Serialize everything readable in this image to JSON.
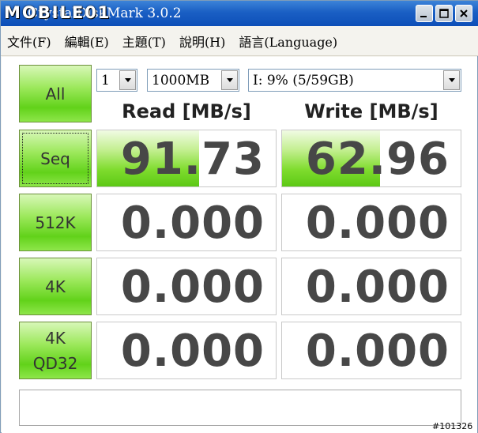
{
  "window": {
    "title": "CrystalDiskMark 3.0.2",
    "watermark": "MOBILE01"
  },
  "menu": [
    {
      "label": "文件(F)"
    },
    {
      "label": "編輯(E)"
    },
    {
      "label": "主題(T)"
    },
    {
      "label": "說明(H)"
    },
    {
      "label": "語言(Language)"
    }
  ],
  "controls": {
    "all_label": "All",
    "count_value": "1",
    "size_value": "1000MB",
    "drive_value": "I: 9% (5/59GB)"
  },
  "headers": {
    "read": "Read [MB/s]",
    "write": "Write [MB/s]"
  },
  "tests": [
    {
      "label_line1": "Seq",
      "label_line2": "",
      "read": "91.73",
      "write": "62.96",
      "read_fill": 0.57,
      "write_fill": 0.55
    },
    {
      "label_line1": "512K",
      "label_line2": "",
      "read": "0.000",
      "write": "0.000",
      "read_fill": 0,
      "write_fill": 0
    },
    {
      "label_line1": "4K",
      "label_line2": "",
      "read": "0.000",
      "write": "0.000",
      "read_fill": 0,
      "write_fill": 0
    },
    {
      "label_line1": "4K",
      "label_line2": "QD32",
      "read": "0.000",
      "write": "0.000",
      "read_fill": 0,
      "write_fill": 0
    }
  ],
  "status_text": "",
  "stamp": "#101326",
  "colors": {
    "button_green": "#62d21a",
    "titlebar_blue": "#1a5fc4"
  }
}
